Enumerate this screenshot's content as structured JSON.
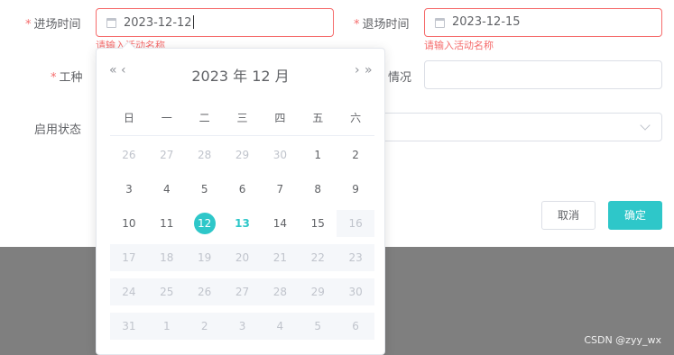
{
  "form": {
    "entry_time": {
      "label": "进场时间",
      "required": "*",
      "value": "2023-12-12",
      "error": "请输入活动名称"
    },
    "exit_time": {
      "label": "退场时间",
      "required": "*",
      "value": "2023-12-15",
      "error": "请输入活动名称"
    },
    "work_type": {
      "label": "工种",
      "required": "*"
    },
    "status_partial": {
      "label": "情况"
    },
    "enable_status": {
      "label": "启用状态"
    }
  },
  "buttons": {
    "cancel": "取消",
    "ok": "确定"
  },
  "watermark": "CSDN @zyy_wx",
  "picker": {
    "prev_year": "«",
    "prev_month": "‹",
    "next_month": "›",
    "next_year": "»",
    "title": "2023 年  12 月",
    "weekdays": [
      "日",
      "一",
      "二",
      "三",
      "四",
      "五",
      "六"
    ],
    "weeks": [
      [
        {
          "d": "26",
          "t": "other"
        },
        {
          "d": "27",
          "t": "other"
        },
        {
          "d": "28",
          "t": "other"
        },
        {
          "d": "29",
          "t": "other"
        },
        {
          "d": "30",
          "t": "other"
        },
        {
          "d": "1",
          "t": "cur"
        },
        {
          "d": "2",
          "t": "cur"
        }
      ],
      [
        {
          "d": "3",
          "t": "cur"
        },
        {
          "d": "4",
          "t": "cur"
        },
        {
          "d": "5",
          "t": "cur"
        },
        {
          "d": "6",
          "t": "cur"
        },
        {
          "d": "7",
          "t": "cur"
        },
        {
          "d": "8",
          "t": "cur"
        },
        {
          "d": "9",
          "t": "cur"
        }
      ],
      [
        {
          "d": "10",
          "t": "cur"
        },
        {
          "d": "11",
          "t": "cur"
        },
        {
          "d": "12",
          "t": "sel"
        },
        {
          "d": "13",
          "t": "today"
        },
        {
          "d": "14",
          "t": "cur"
        },
        {
          "d": "15",
          "t": "cur"
        },
        {
          "d": "16",
          "t": "dis"
        }
      ],
      [
        {
          "d": "17",
          "t": "dis"
        },
        {
          "d": "18",
          "t": "dis"
        },
        {
          "d": "19",
          "t": "dis"
        },
        {
          "d": "20",
          "t": "dis"
        },
        {
          "d": "21",
          "t": "dis"
        },
        {
          "d": "22",
          "t": "dis"
        },
        {
          "d": "23",
          "t": "dis"
        }
      ],
      [
        {
          "d": "24",
          "t": "dis"
        },
        {
          "d": "25",
          "t": "dis"
        },
        {
          "d": "26",
          "t": "dis"
        },
        {
          "d": "27",
          "t": "dis"
        },
        {
          "d": "28",
          "t": "dis"
        },
        {
          "d": "29",
          "t": "dis"
        },
        {
          "d": "30",
          "t": "dis"
        }
      ],
      [
        {
          "d": "31",
          "t": "dis"
        },
        {
          "d": "1",
          "t": "dis"
        },
        {
          "d": "2",
          "t": "dis"
        },
        {
          "d": "3",
          "t": "dis"
        },
        {
          "d": "4",
          "t": "dis"
        },
        {
          "d": "5",
          "t": "dis"
        },
        {
          "d": "6",
          "t": "dis"
        }
      ]
    ]
  },
  "colors": {
    "accent": "#2ec7c9",
    "error": "#f56c6c",
    "overlay": "#7f7f7f"
  }
}
